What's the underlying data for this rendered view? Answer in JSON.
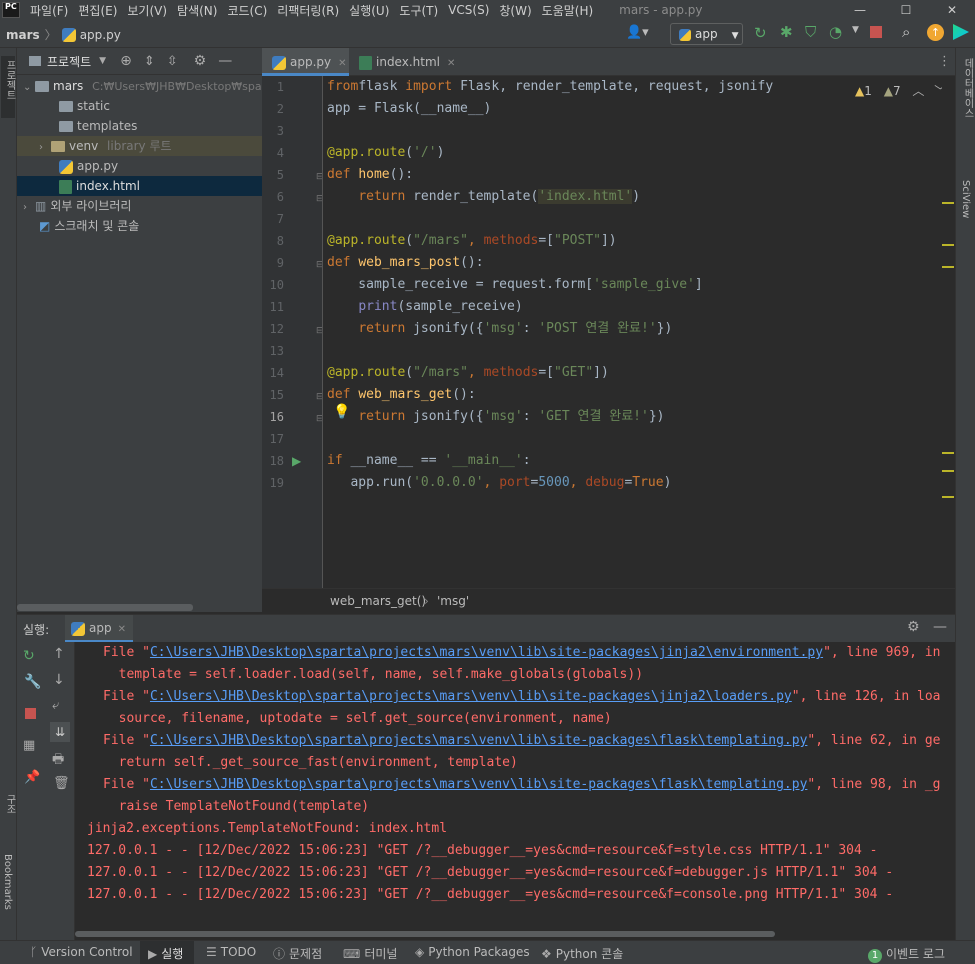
{
  "menu": {
    "items": [
      "파일(F)",
      "편집(E)",
      "보기(V)",
      "탐색(N)",
      "코드(C)",
      "리팩터링(R)",
      "실행(U)",
      "도구(T)",
      "VCS(S)",
      "창(W)",
      "도움말(H)"
    ],
    "window_title": "mars - app.py"
  },
  "nav": {
    "project": "mars",
    "file": "app.py",
    "run_config": "app"
  },
  "left_stripe": {
    "project_label": "프로젝트",
    "structure_label": "구조",
    "bookmarks_label": "Bookmarks"
  },
  "right_stripe": {
    "database_label": "데이터베이스",
    "sciview_label": "SciView"
  },
  "project_panel": {
    "title": "프로젝트",
    "tree": [
      {
        "label": "mars",
        "hint": "C:₩Users₩JHB₩Desktop₩sparta"
      },
      {
        "label": "static",
        "hint": ""
      },
      {
        "label": "templates",
        "hint": ""
      },
      {
        "label": "venv",
        "hint": "library 루트"
      },
      {
        "label": "app.py",
        "hint": ""
      },
      {
        "label": "index.html",
        "hint": ""
      },
      {
        "label": "외부 라이브러리",
        "hint": ""
      },
      {
        "label": "스크래치 및 콘솔",
        "hint": ""
      }
    ]
  },
  "editor": {
    "tabs": [
      {
        "label": "app.py"
      },
      {
        "label": "index.html"
      }
    ],
    "inspections": {
      "warnings": "1",
      "weak_warnings": "7"
    },
    "line_numbers": [
      "1",
      "2",
      "3",
      "4",
      "5",
      "6",
      "7",
      "8",
      "9",
      "10",
      "11",
      "12",
      "13",
      "14",
      "15",
      "16",
      "17",
      "18",
      "19"
    ],
    "breadcrumb": [
      "web_mars_get()",
      "'msg'"
    ]
  },
  "run_panel": {
    "label": "실행:",
    "tab": "app",
    "output": [
      {
        "pre": "File \"",
        "link": "C:\\Users\\JHB\\Desktop\\sparta\\projects\\mars\\venv\\lib\\site-packages\\jinja2\\environment.py",
        "post": "\", line 969, in"
      },
      {
        "pre": "  template = self.loader.load(self, name, self.make_globals(globals))",
        "link": "",
        "post": ""
      },
      {
        "pre": "File \"",
        "link": "C:\\Users\\JHB\\Desktop\\sparta\\projects\\mars\\venv\\lib\\site-packages\\jinja2\\loaders.py",
        "post": "\", line 126, in loa"
      },
      {
        "pre": "  source, filename, uptodate = self.get_source(environment, name)",
        "link": "",
        "post": ""
      },
      {
        "pre": "File \"",
        "link": "C:\\Users\\JHB\\Desktop\\sparta\\projects\\mars\\venv\\lib\\site-packages\\flask\\templating.py",
        "post": "\", line 62, in ge"
      },
      {
        "pre": "  return self._get_source_fast(environment, template)",
        "link": "",
        "post": ""
      },
      {
        "pre": "File \"",
        "link": "C:\\Users\\JHB\\Desktop\\sparta\\projects\\mars\\venv\\lib\\site-packages\\flask\\templating.py",
        "post": "\", line 98, in _g"
      },
      {
        "pre": "  raise TemplateNotFound(template)",
        "link": "",
        "post": ""
      },
      {
        "pre": "jinja2.exceptions.TemplateNotFound: index.html",
        "link": "",
        "post": ""
      },
      {
        "pre": "127.0.0.1 - - [12/Dec/2022 15:06:23] \"GET /?__debugger__=yes&cmd=resource&f=style.css HTTP/1.1\" 304 -",
        "link": "",
        "post": ""
      },
      {
        "pre": "127.0.0.1 - - [12/Dec/2022 15:06:23] \"GET /?__debugger__=yes&cmd=resource&f=debugger.js HTTP/1.1\" 304 -",
        "link": "",
        "post": ""
      },
      {
        "pre": "127.0.0.1 - - [12/Dec/2022 15:06:23] \"GET /?__debugger__=yes&cmd=resource&f=console.png HTTP/1.1\" 304 -",
        "link": "",
        "post": ""
      }
    ]
  },
  "statusbar": {
    "version_control": "Version Control",
    "run": "실행",
    "todo": "TODO",
    "problems": "문제점",
    "terminal": "터미널",
    "python_packages": "Python Packages",
    "python_console": "Python 콘솔",
    "event_count": "1",
    "event_log": "이벤트 로그"
  }
}
